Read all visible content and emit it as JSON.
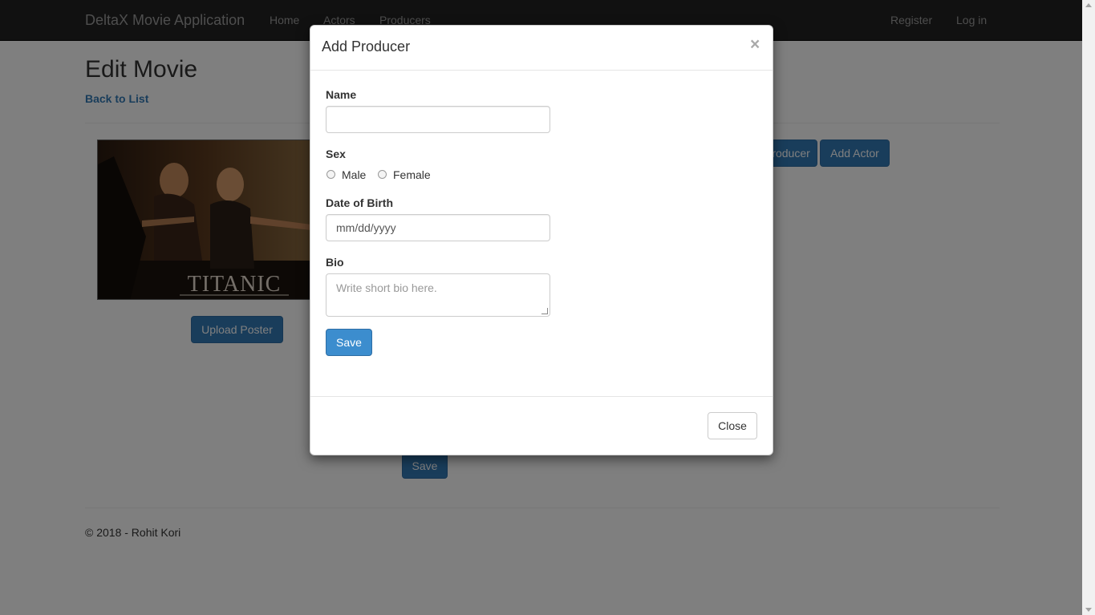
{
  "navbar": {
    "brand": "DeltaX Movie Application",
    "links": [
      "Home",
      "Actors",
      "Producers"
    ],
    "right_links": [
      "Register",
      "Log in"
    ]
  },
  "page": {
    "title": "Edit Movie",
    "back_link": "Back to List",
    "poster_text": "TITANIC",
    "upload_button": "Upload Poster",
    "add_producer_button": "Add Producer",
    "add_actor_button": "Add Actor",
    "save_button": "Save",
    "footer": "© 2018 - Rohit Kori"
  },
  "modal": {
    "title": "Add Producer",
    "close_x": "×",
    "name_label": "Name",
    "name_value": "",
    "sex_label": "Sex",
    "sex_options": [
      "Male",
      "Female"
    ],
    "dob_label": "Date of Birth",
    "dob_placeholder": "mm/dd/yyyy",
    "bio_label": "Bio",
    "bio_placeholder": "Write short bio here.",
    "save_button": "Save",
    "close_button": "Close"
  },
  "colors": {
    "navbar_bg": "#222222",
    "primary": "#337ab7",
    "link": "#337ab7"
  }
}
